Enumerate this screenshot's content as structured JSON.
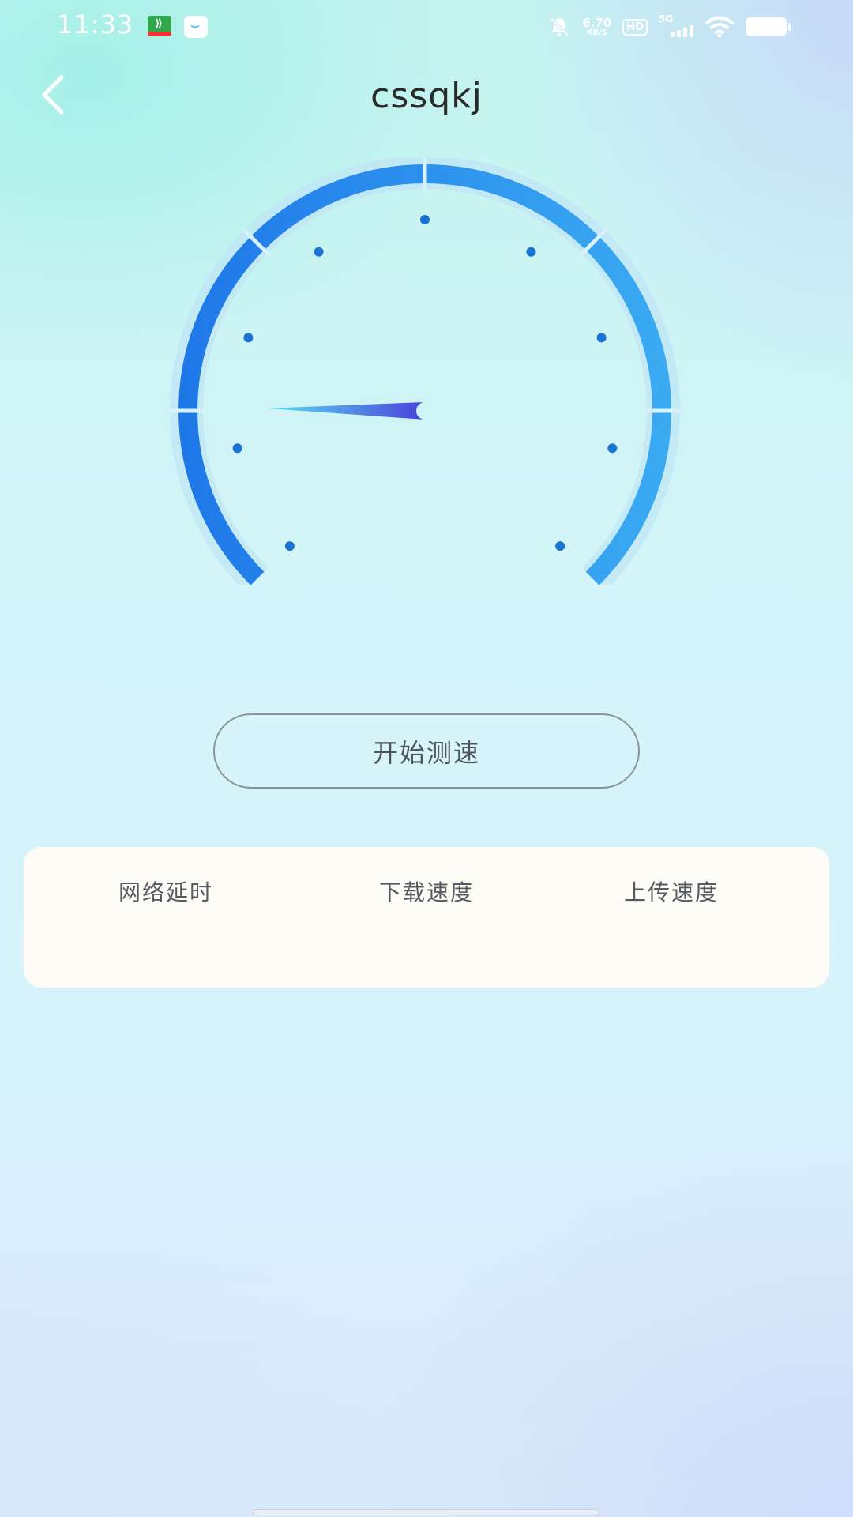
{
  "status_bar": {
    "time": "11:33",
    "net_speed_value": "6.70",
    "net_speed_unit": "KB/S",
    "hd_badge": "HD",
    "signal_label": "5G",
    "icons": [
      "running-app-icon",
      "mail-app-icon",
      "bell-mute-icon",
      "hd-icon",
      "signal-icon",
      "wifi-icon",
      "battery-icon"
    ]
  },
  "header": {
    "title": "cssqkj",
    "back_icon": "chevron-left-icon"
  },
  "gauge": {
    "needle_level": 0.17,
    "colors": {
      "arc_start": "#1f78e8",
      "arc_end": "#3aaaf2",
      "tick_dot": "#1c74d2",
      "needle_start": "#5ce0f0",
      "needle_end": "#4a40dc"
    }
  },
  "actions": {
    "start_label": "开始测速"
  },
  "results": {
    "latency_label": "网络延时",
    "download_label": "下载速度",
    "upload_label": "上传速度"
  }
}
